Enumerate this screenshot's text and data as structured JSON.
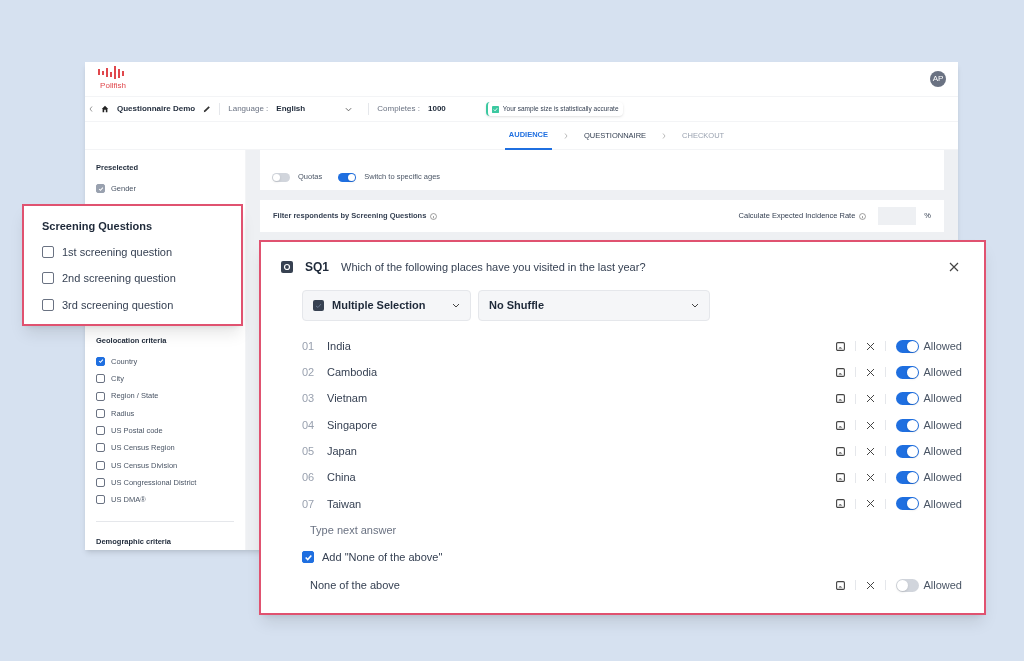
{
  "app": {
    "logo_text": "Pollfish",
    "avatar": "AP"
  },
  "toolbar": {
    "project": "Questionnaire Demo",
    "language_label": "Language :",
    "language": "English",
    "completes_label": "Completes :",
    "completes": "1000",
    "notice": "Your sample size is statistically accurate"
  },
  "steps": [
    {
      "label": "AUDIENCE",
      "selected": true,
      "disabled": false
    },
    {
      "label": "QUESTIONNAIRE",
      "selected": false,
      "disabled": false
    },
    {
      "label": "CHECKOUT",
      "selected": false,
      "disabled": true
    }
  ],
  "sidebar": {
    "sections": [
      {
        "title": "Preselected",
        "items": [
          {
            "label": "Gender",
            "checked": true,
            "disabled": true
          }
        ]
      },
      {
        "title": "Geolocation criteria",
        "items": [
          {
            "label": "Country",
            "checked": true,
            "disabled": false
          },
          {
            "label": "City",
            "checked": false,
            "disabled": false
          },
          {
            "label": "Region / State",
            "checked": false,
            "disabled": false
          },
          {
            "label": "Radius",
            "checked": false,
            "disabled": false
          },
          {
            "label": "US Postal code",
            "checked": false,
            "disabled": false
          },
          {
            "label": "US Census Region",
            "checked": false,
            "disabled": false
          },
          {
            "label": "US Census Division",
            "checked": false,
            "disabled": false
          },
          {
            "label": "US Congressional District",
            "checked": false,
            "disabled": false
          },
          {
            "label": "US DMA®",
            "checked": false,
            "disabled": false
          }
        ]
      },
      {
        "title": "Demographic criteria"
      }
    ]
  },
  "switches": [
    {
      "label": "Quotas",
      "on": false
    },
    {
      "label": "Switch to specific ages",
      "on": true
    }
  ],
  "filter": {
    "label": "Filter respondents by Screening Questions",
    "incidence_label": "Calculate Expected Incidence Rate",
    "unit": "%"
  },
  "screening_popup": {
    "title": "Screening Questions",
    "items": [
      {
        "label": "1st screening question",
        "checked": false
      },
      {
        "label": "2nd screening question",
        "checked": false
      },
      {
        "label": "3rd screening question",
        "checked": false
      }
    ]
  },
  "question": {
    "code": "SQ1",
    "text": "Which of the following places have you visited in the last year?",
    "type": "Multiple Selection",
    "order": "No Shuffle",
    "answers": [
      {
        "number": "01",
        "label": "India",
        "allowed": true,
        "toggle_label": "Allowed"
      },
      {
        "number": "02",
        "label": "Cambodia",
        "allowed": true,
        "toggle_label": "Allowed"
      },
      {
        "number": "03",
        "label": "Vietnam",
        "allowed": true,
        "toggle_label": "Allowed"
      },
      {
        "number": "04",
        "label": "Singapore",
        "allowed": true,
        "toggle_label": "Allowed"
      },
      {
        "number": "05",
        "label": "Japan",
        "allowed": true,
        "toggle_label": "Allowed"
      },
      {
        "number": "06",
        "label": "China",
        "allowed": true,
        "toggle_label": "Allowed"
      },
      {
        "number": "07",
        "label": "Taiwan",
        "allowed": true,
        "toggle_label": "Allowed"
      }
    ],
    "next_placeholder": "Type next answer",
    "none_option": {
      "label": "Add \"None of the above\"",
      "checked": true
    },
    "none_answer": {
      "label": "None of the above",
      "allowed": false,
      "toggle_label": "Allowed"
    }
  }
}
